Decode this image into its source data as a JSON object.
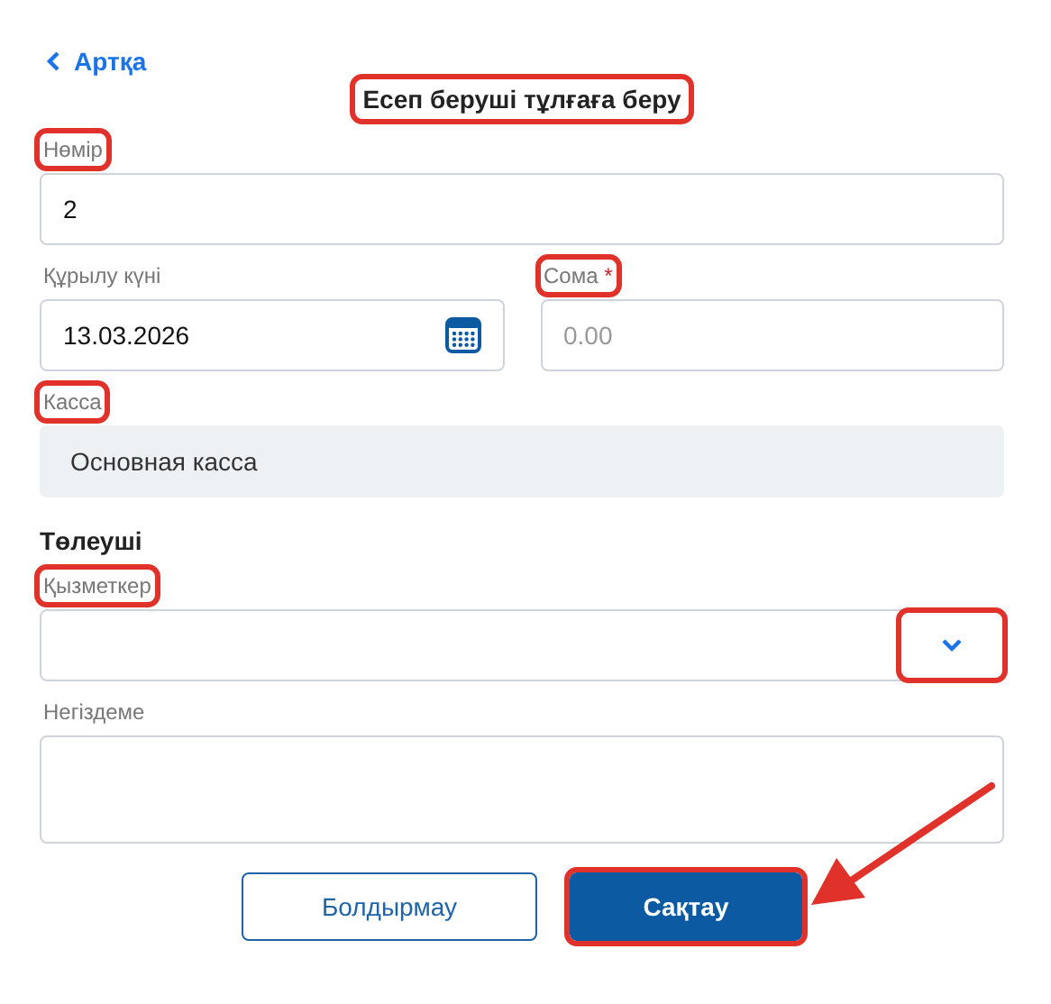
{
  "back": {
    "label": "Артқа"
  },
  "title": {
    "text": "Есеп беруші тұлғаға беру",
    "highlighted": true
  },
  "rows": [
    {
      "fields": [
        {
          "kind": "text",
          "label": "Нөмір",
          "label_highlighted": true,
          "value": "2"
        }
      ]
    },
    {
      "fields": [
        {
          "kind": "date",
          "label": "Құрылу күні",
          "label_highlighted": false,
          "value": "13.03.2026"
        },
        {
          "kind": "number",
          "label": "Сома",
          "required_mark": "*",
          "label_highlighted": true,
          "placeholder": "0.00"
        }
      ]
    },
    {
      "fields": [
        {
          "kind": "readonly",
          "label": "Касса",
          "label_highlighted": true,
          "value": "Основная касса"
        }
      ]
    }
  ],
  "payer": {
    "heading": "Төлеуші",
    "rows": [
      {
        "fields": [
          {
            "kind": "select",
            "label": "Қызметкер",
            "label_highlighted": true,
            "caret_highlighted": true
          }
        ]
      },
      {
        "fields": [
          {
            "kind": "textarea",
            "label": "Негіздеме",
            "label_highlighted": false
          }
        ]
      }
    ]
  },
  "buttons": [
    {
      "kind": "secondary",
      "label": "Болдырмау",
      "highlighted": false
    },
    {
      "kind": "primary",
      "label": "Сақтау",
      "highlighted": true
    }
  ],
  "annotation_arrow": true
}
